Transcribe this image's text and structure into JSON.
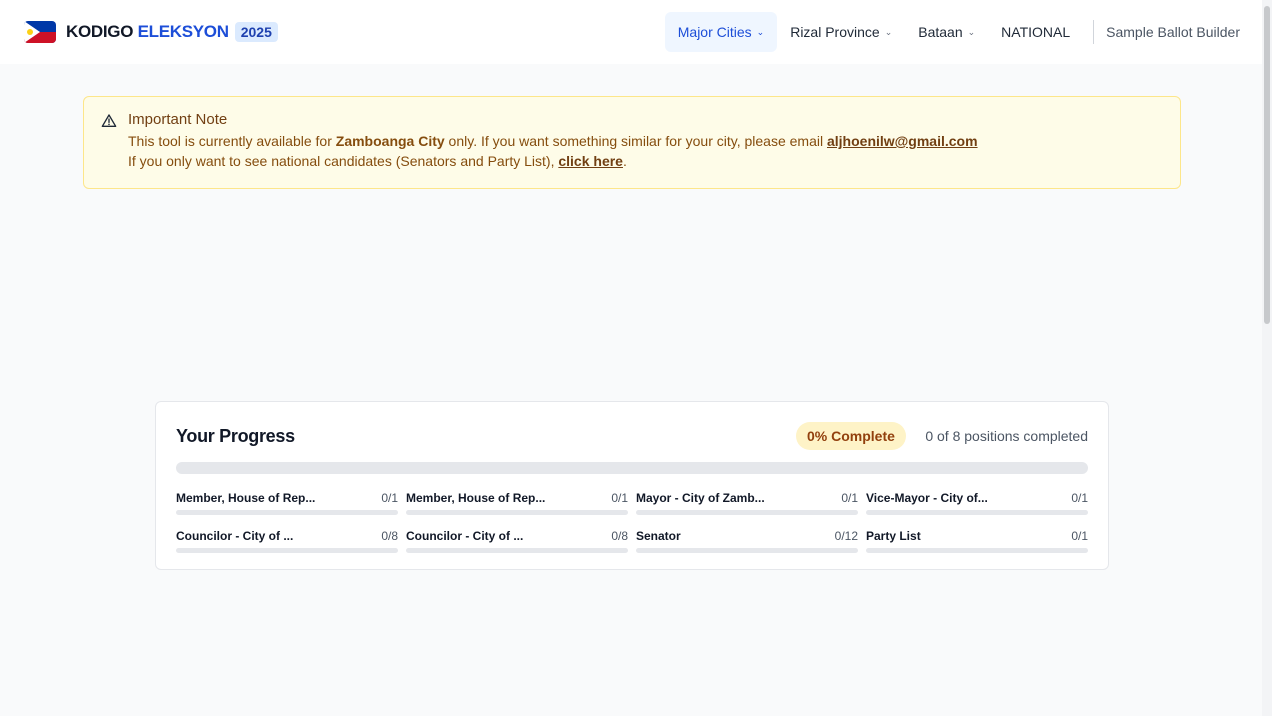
{
  "brand": {
    "name_part1": "KODIGO",
    "name_part2": "ELEKSYON",
    "year": "2025"
  },
  "nav": {
    "items": [
      {
        "label": "Major Cities",
        "chevron": "⌄",
        "active": true
      },
      {
        "label": "Rizal Province",
        "chevron": "⌄",
        "active": false
      },
      {
        "label": "Bataan",
        "chevron": "⌄",
        "active": false
      },
      {
        "label": "NATIONAL"
      }
    ],
    "builder_label": "Sample Ballot Builder"
  },
  "notice": {
    "icon": "warning-triangle-icon",
    "title": "Important Note",
    "line1_a": "This tool is currently available for ",
    "line1_city": "Zamboanga City",
    "line1_b": " only. If you want something similar for your city, please email ",
    "email": "aljhoenilw@gmail.com",
    "line2_a": "If you only want to see national candidates (Senators and Party List), ",
    "line2_link": "click here",
    "line2_b": "."
  },
  "progress": {
    "title": "Your Progress",
    "badge": "0% Complete",
    "summary": "0 of 8 positions completed",
    "fraction": 0,
    "positions": [
      {
        "name": "Member, House of Rep...",
        "count": "0/1",
        "fraction": 0
      },
      {
        "name": "Member, House of Rep...",
        "count": "0/1",
        "fraction": 0
      },
      {
        "name": "Mayor - City of Zamb...",
        "count": "0/1",
        "fraction": 0
      },
      {
        "name": "Vice-Mayor - City of...",
        "count": "0/1",
        "fraction": 0
      },
      {
        "name": "Councilor - City of ...",
        "count": "0/8",
        "fraction": 0
      },
      {
        "name": "Councilor - City of ...",
        "count": "0/8",
        "fraction": 0
      },
      {
        "name": "Senator",
        "count": "0/12",
        "fraction": 0
      },
      {
        "name": "Party List",
        "count": "0/1",
        "fraction": 0
      }
    ]
  },
  "colors": {
    "accent": "#1d4ed8",
    "warning_bg": "#fefce8",
    "warning_text": "#854d0e",
    "badge_bg": "#fef3c7"
  }
}
